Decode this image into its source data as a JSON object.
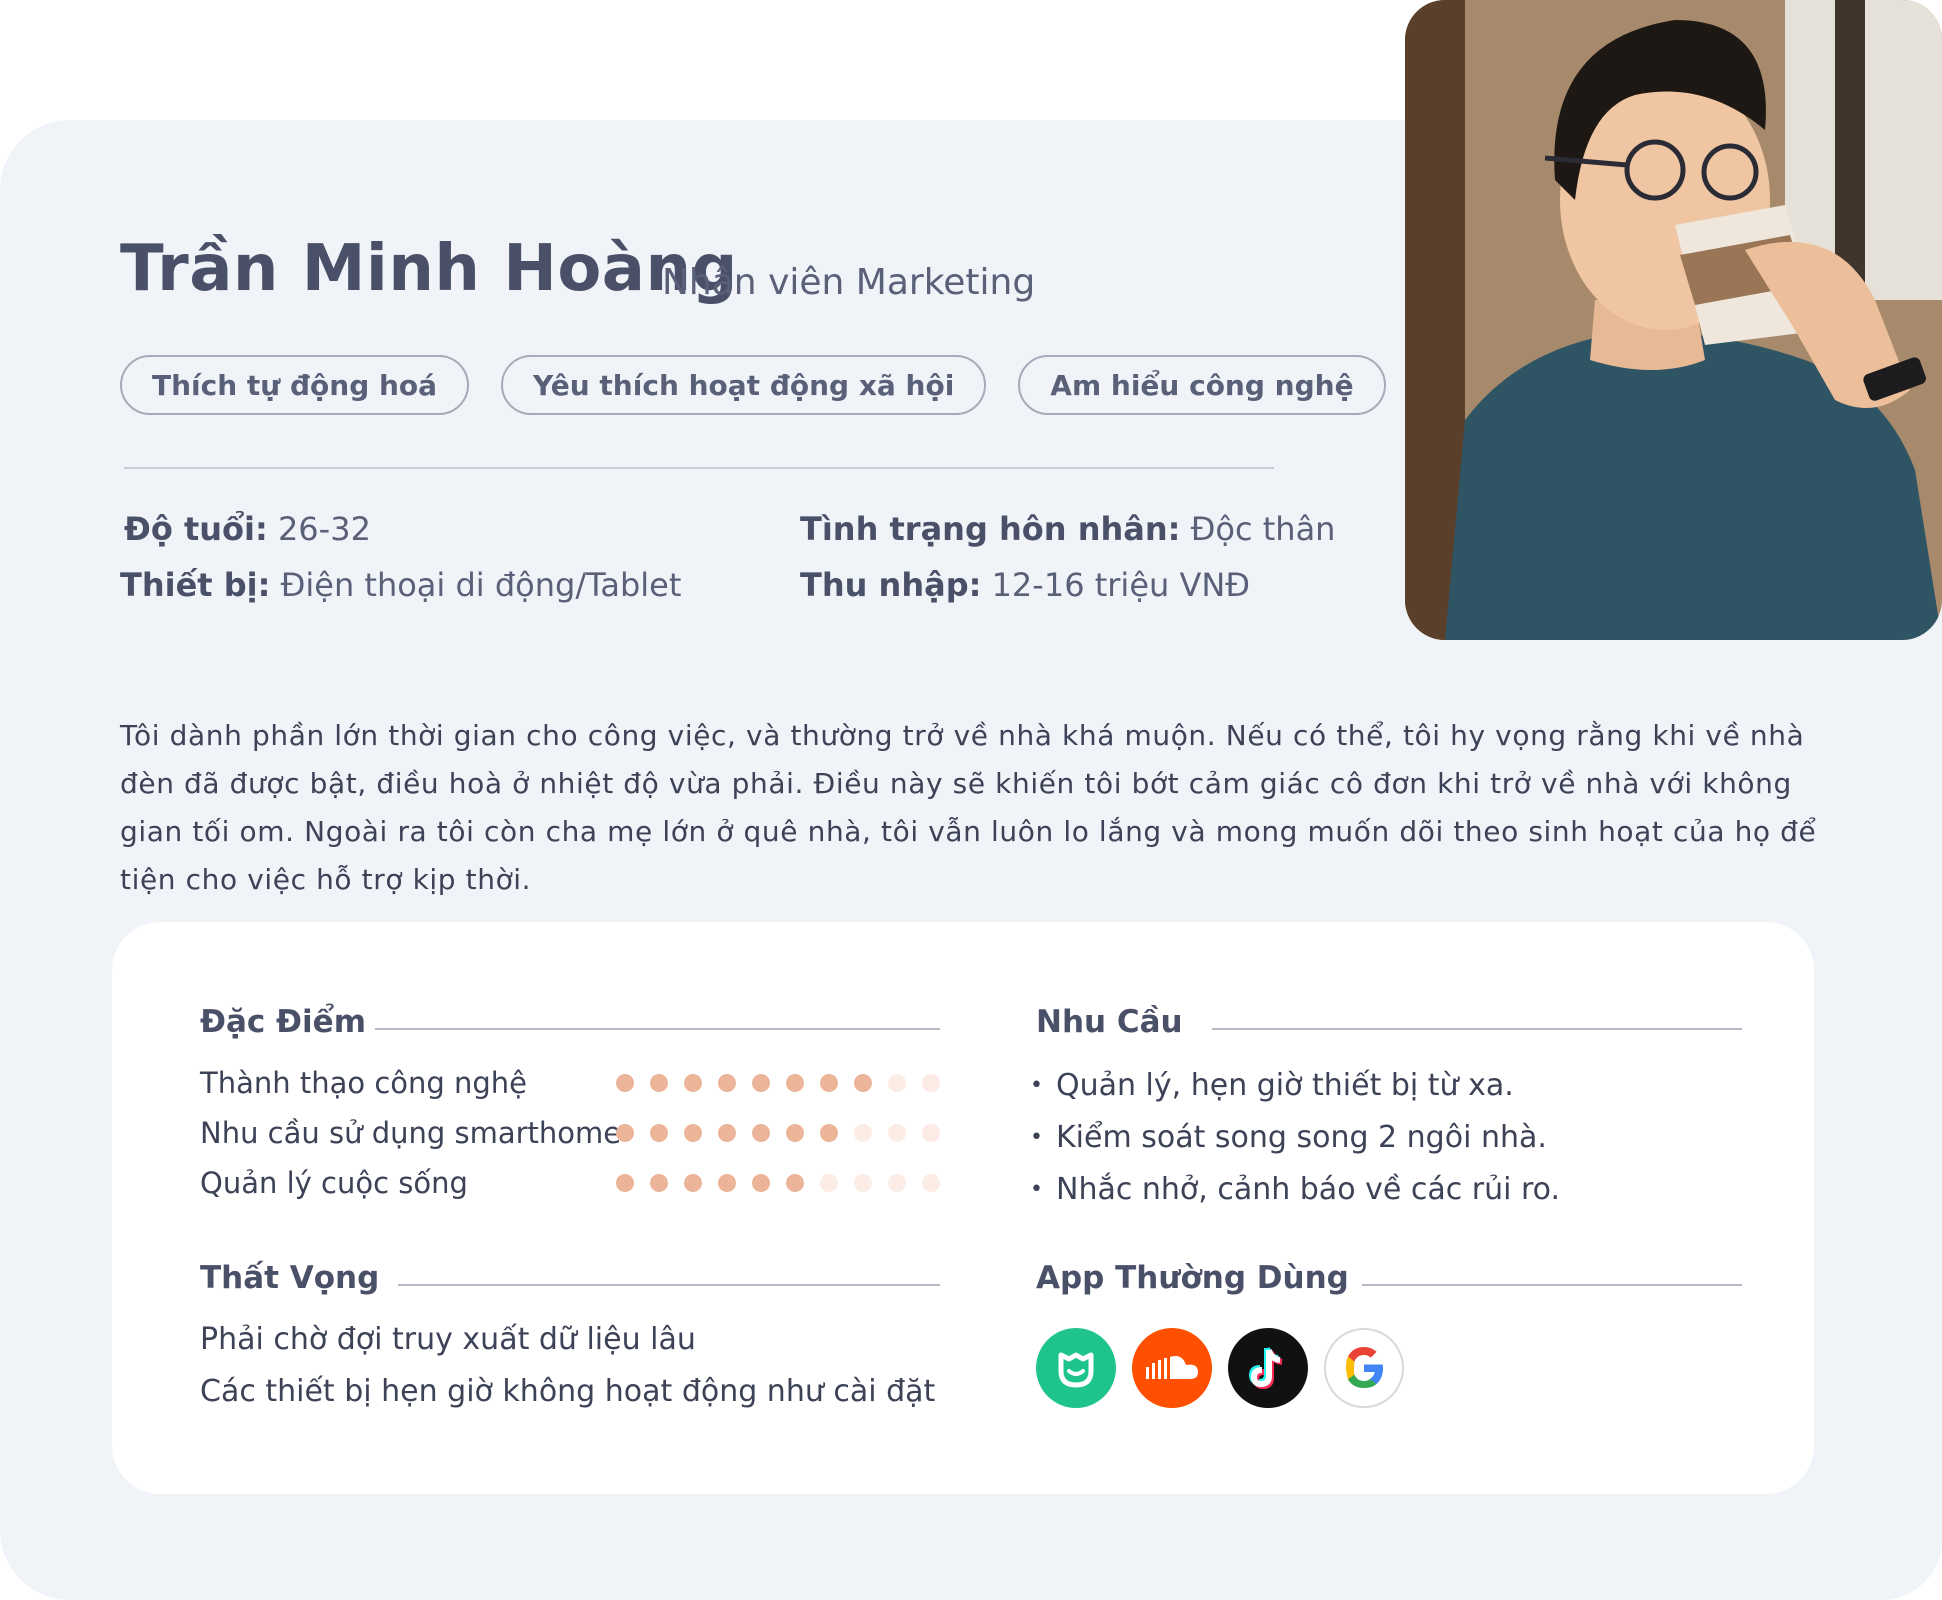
{
  "profile": {
    "name": "Trần Minh Hoàng",
    "role": "Nhân viên Marketing",
    "tags": [
      "Thích tự động hoá",
      "Yêu thích hoạt động xã hội",
      "Am hiểu công nghệ"
    ],
    "facts": {
      "age_label": "Độ tuổi:",
      "age_value": " 26-32",
      "device_label": "Thiết bị:",
      "device_value": " Điện thoại di động/Tablet",
      "marital_label": "Tình trạng hôn nhân:",
      "marital_value": " Độc thân",
      "income_label": "Thu nhập:",
      "income_value": " 12-16 triệu VNĐ"
    },
    "bio": "Tôi dành phần lớn thời gian cho công việc, và thường trở về nhà khá muộn. Nếu có thể, tôi hy vọng rằng khi về nhà đèn đã được bật, điều hoà ở nhiệt độ vừa phải. Điều này sẽ khiến tôi bớt cảm giác cô đơn khi trở về nhà với không gian tối om. Ngoài ra tôi còn cha mẹ lớn ở quê nhà, tôi vẫn luôn lo lắng và mong muốn dõi theo sinh hoạt của họ để tiện cho việc hỗ trợ kịp thời."
  },
  "traits": {
    "title": "Đặc Điểm",
    "max": 10,
    "items": [
      {
        "label": "Thành thạo công nghệ",
        "value": 8
      },
      {
        "label": "Nhu cầu sử dụng smarthome",
        "value": 7
      },
      {
        "label": "Quản lý cuộc sống",
        "value": 6
      }
    ]
  },
  "needs": {
    "title": "Nhu Cầu",
    "items": [
      "Quản lý, hẹn giờ thiết bị từ xa.",
      "Kiểm soát song song 2 ngôi nhà.",
      "Nhắc nhở, cảnh báo về các rủi ro."
    ]
  },
  "frustrations": {
    "title": "Thất Vọng",
    "items": [
      "Phải chờ đợi truy xuất dữ liệu lâu",
      "Các thiết bị hẹn giờ không hoạt động như cài đặt"
    ]
  },
  "apps": {
    "title": "App Thường Dùng",
    "icons": [
      "mi-home-icon",
      "soundcloud-icon",
      "tiktok-icon",
      "google-icon"
    ]
  },
  "colors": {
    "dot_on": "#ecb59a",
    "dot_off": "#fbece6",
    "mihome": "#1fc48c",
    "soundcloud": "#fe5000",
    "tiktok": "#111111"
  }
}
